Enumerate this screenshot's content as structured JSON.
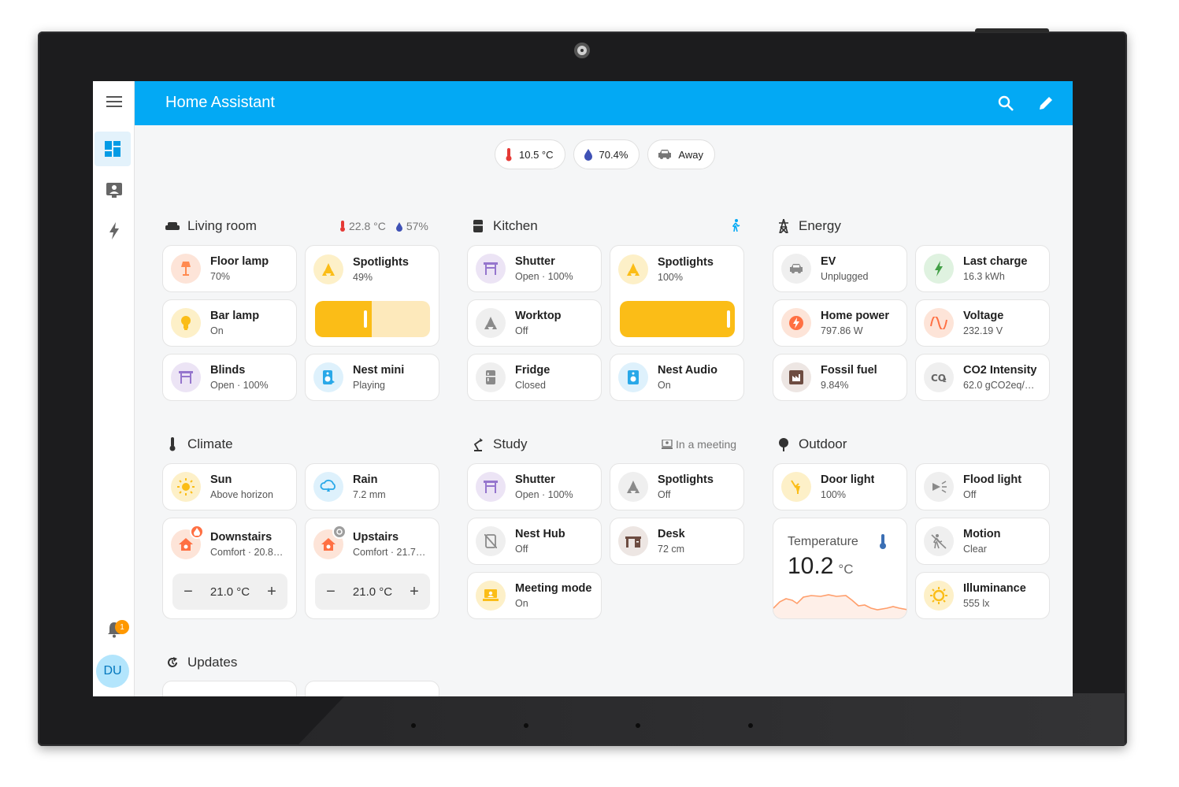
{
  "app": {
    "title": "Home Assistant"
  },
  "sidebar": {
    "items": [
      {
        "icon": "menu-icon"
      },
      {
        "icon": "dashboard-icon"
      },
      {
        "icon": "person-card-icon"
      },
      {
        "icon": "energy-icon"
      }
    ],
    "notifications_count": "1",
    "user_initials": "DU"
  },
  "badges": [
    {
      "icon": "thermometer-icon",
      "value": "10.5 °C"
    },
    {
      "icon": "water-drop-icon",
      "value": "70.4%"
    },
    {
      "icon": "car-icon",
      "value": "Away"
    }
  ],
  "sections": {
    "living_room": {
      "title": "Living room",
      "temp": "22.8 °C",
      "humidity": "57%",
      "tiles": [
        {
          "name": "Floor lamp",
          "state": "70%"
        },
        {
          "name": "Spotlights",
          "state": "49%"
        },
        {
          "name": "Bar lamp",
          "state": "On"
        },
        {
          "name": "Blinds",
          "state": "Open · 100%"
        },
        {
          "name": "Nest mini",
          "state": "Playing"
        }
      ],
      "spotlights_level": 0.49
    },
    "kitchen": {
      "title": "Kitchen",
      "tiles": [
        {
          "name": "Shutter",
          "state": "Open · 100%"
        },
        {
          "name": "Spotlights",
          "state": "100%"
        },
        {
          "name": "Worktop",
          "state": "Off"
        },
        {
          "name": "Fridge",
          "state": "Closed"
        },
        {
          "name": "Nest Audio",
          "state": "On"
        }
      ],
      "spotlights_level": 1.0
    },
    "energy": {
      "title": "Energy",
      "tiles": [
        {
          "name": "EV",
          "state": "Unplugged"
        },
        {
          "name": "Last charge",
          "state": "16.3 kWh"
        },
        {
          "name": "Home power",
          "state": "797.86 W"
        },
        {
          "name": "Voltage",
          "state": "232.19 V"
        },
        {
          "name": "Fossil fuel",
          "state": "9.84%"
        },
        {
          "name": "CO2 Intensity",
          "state": "62.0 gCO2eq/…"
        }
      ]
    },
    "climate": {
      "title": "Climate",
      "tiles": [
        {
          "name": "Sun",
          "state": "Above horizon"
        },
        {
          "name": "Rain",
          "state": "7.2 mm"
        },
        {
          "name": "Downstairs",
          "state": "Comfort · 20.8…",
          "setpoint": "21.0 °C"
        },
        {
          "name": "Upstairs",
          "state": "Comfort · 21.7…",
          "setpoint": "21.0 °C"
        }
      ]
    },
    "study": {
      "title": "Study",
      "status": "In a meeting",
      "tiles": [
        {
          "name": "Shutter",
          "state": "Open · 100%"
        },
        {
          "name": "Spotlights",
          "state": "Off"
        },
        {
          "name": "Nest Hub",
          "state": "Off"
        },
        {
          "name": "Desk",
          "state": "72 cm"
        },
        {
          "name": "Meeting mode",
          "state": "On"
        }
      ]
    },
    "outdoor": {
      "title": "Outdoor",
      "tiles": [
        {
          "name": "Door light",
          "state": "100%"
        },
        {
          "name": "Flood light",
          "state": "Off"
        },
        {
          "name": "Motion",
          "state": "Clear"
        },
        {
          "name": "Illuminance",
          "state": "555 lx"
        }
      ],
      "temperature": {
        "label": "Temperature",
        "value": "10.2",
        "unit": "°C"
      }
    },
    "updates": {
      "title": "Updates"
    }
  },
  "colors": {
    "accent": "#03a9f4",
    "light_on": "#fbbd17",
    "heat": "#ff7043"
  }
}
